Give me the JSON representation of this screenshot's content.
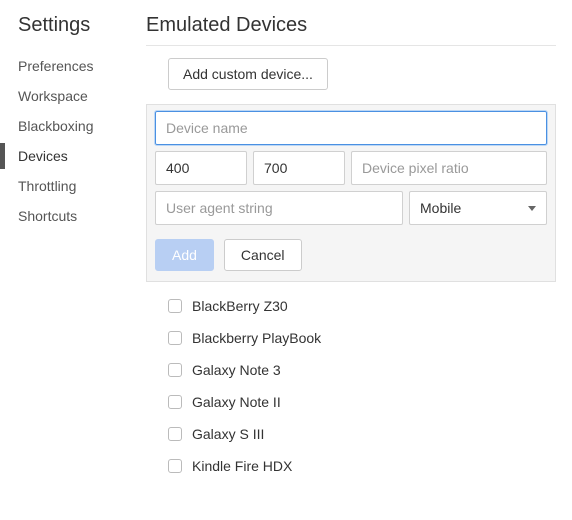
{
  "sidebar": {
    "title": "Settings",
    "items": [
      {
        "label": "Preferences",
        "active": false
      },
      {
        "label": "Workspace",
        "active": false
      },
      {
        "label": "Blackboxing",
        "active": false
      },
      {
        "label": "Devices",
        "active": true
      },
      {
        "label": "Throttling",
        "active": false
      },
      {
        "label": "Shortcuts",
        "active": false
      }
    ]
  },
  "main": {
    "title": "Emulated Devices",
    "add_custom_label": "Add custom device...",
    "form": {
      "device_name_placeholder": "Device name",
      "device_name_value": "",
      "width_value": "400",
      "height_value": "700",
      "pixel_ratio_placeholder": "Device pixel ratio",
      "pixel_ratio_value": "",
      "ua_placeholder": "User agent string",
      "ua_value": "",
      "type_value": "Mobile",
      "add_label": "Add",
      "cancel_label": "Cancel"
    },
    "devices": [
      {
        "label": "BlackBerry Z30",
        "checked": false
      },
      {
        "label": "Blackberry PlayBook",
        "checked": false
      },
      {
        "label": "Galaxy Note 3",
        "checked": false
      },
      {
        "label": "Galaxy Note II",
        "checked": false
      },
      {
        "label": "Galaxy S III",
        "checked": false
      },
      {
        "label": "Kindle Fire HDX",
        "checked": false
      }
    ]
  }
}
